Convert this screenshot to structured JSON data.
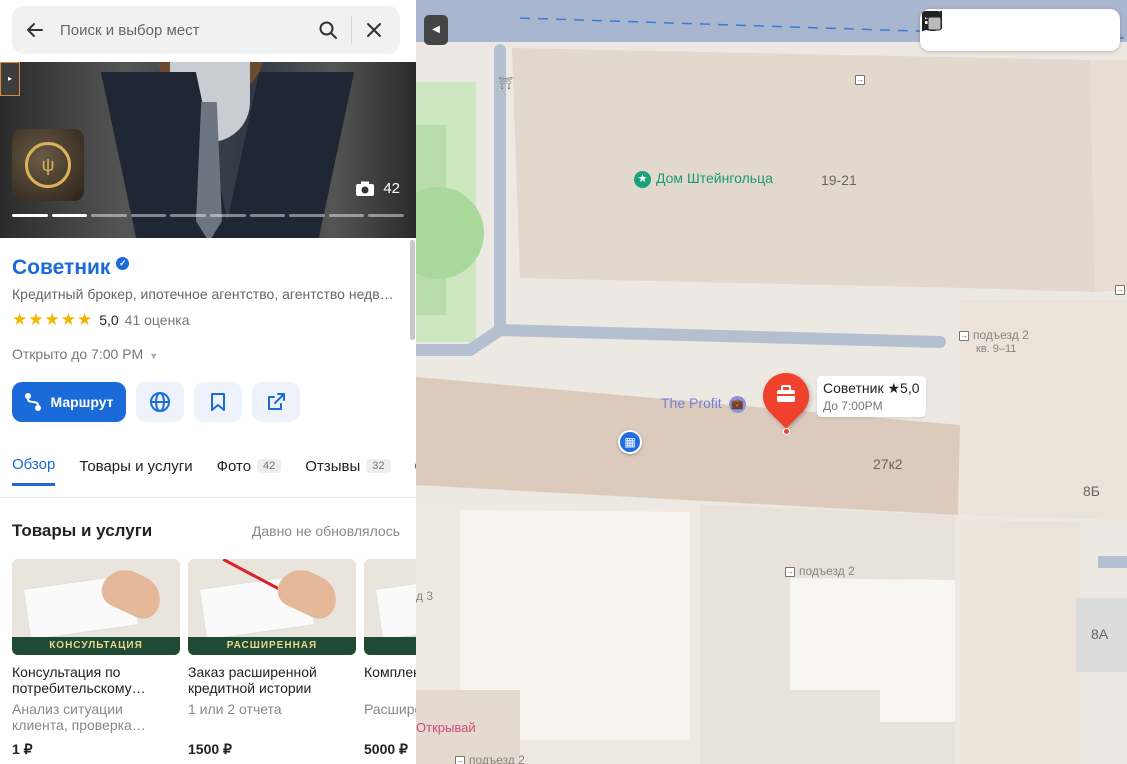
{
  "search": {
    "placeholder": "Поиск и выбор мест"
  },
  "place": {
    "name": "Советник",
    "categories": "Кредитный брокер, ипотечное агентство, агентство недв…",
    "rating": "5,0",
    "stars": "★★★★★",
    "reviews_count": "41 оценка",
    "hours": "Открыто до 7:00 PM",
    "photo_count": "42"
  },
  "actions": {
    "route_label": "Маршрут"
  },
  "tabs": [
    {
      "label": "Обзор",
      "badge": ""
    },
    {
      "label": "Товары и услуги",
      "badge": ""
    },
    {
      "label": "Фото",
      "badge": "42"
    },
    {
      "label": "Отзывы",
      "badge": "32"
    },
    {
      "label": "О",
      "badge": ""
    }
  ],
  "products_section": {
    "title": "Товары и услуги",
    "note": "Давно не обновлялось"
  },
  "products": [
    {
      "name": "Консультация по потребительскому…",
      "desc": "Анализ ситуации клиента, проверка…",
      "price": "1 ₽",
      "ribbon": "КОНСУЛЬТАЦИЯ"
    },
    {
      "name": "Заказ расширенной кредитной истории",
      "desc": "1 или 2 отчета",
      "price": "1500 ₽",
      "ribbon": "РАСШИРЕННАЯ"
    },
    {
      "name": "Комплекс клиента",
      "desc": "Расширенная история",
      "price": "5000 ₽",
      "ribbon": "К"
    }
  ],
  "map": {
    "labels": {
      "poi": "Дом Штейнгольца",
      "bldg_1921": "19-21",
      "entrance2_top": "подъезд 2",
      "kv": "кв. 9–11",
      "profit": "The Profit",
      "bldg_27k2": "27к2",
      "bldg_8b": "8Б",
      "entrance2_mid": "подъезд 2",
      "entrance3": "д 3",
      "bldg_8a": "8А",
      "open_label": "Открывай",
      "entrance2_bottom": "подъезд 2"
    },
    "pin": {
      "title": "Советник ★5,0",
      "subtitle": "До 7:00PM"
    }
  },
  "colors": {
    "accent": "#1a6bd9",
    "pin": "#f0412c",
    "poi": "#1aa37a"
  }
}
